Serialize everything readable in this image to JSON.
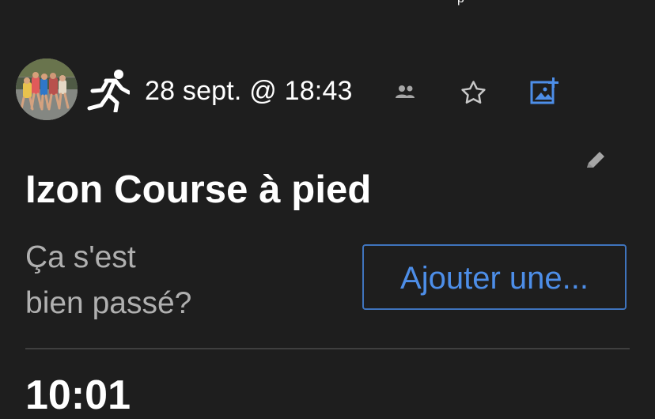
{
  "top_status": {
    "partial_label": "p"
  },
  "activity": {
    "avatar_alt": "Photo de profil",
    "sport_icon": "running-icon",
    "date_time": "28 sept. @ 18:43",
    "visibility_icon": "group-icon",
    "favorite_icon": "star-icon",
    "add_media_icon": "add-photo-icon",
    "title": "Izon Course à pied",
    "edit_icon": "pencil-icon"
  },
  "feedback": {
    "prompt_line_1": "Ça s'est",
    "prompt_line_2": "bien passé?",
    "add_button_label": "Ajouter une..."
  },
  "stats": {
    "partial_value": "10:01"
  },
  "colors": {
    "background": "#1e1e1e",
    "primary_text": "#ffffff",
    "secondary_text": "#b0b0b0",
    "muted_icon": "#a6a6a6",
    "accent": "#4d8ee8",
    "button_border": "#3f74bd",
    "divider": "#3f3f3f"
  }
}
